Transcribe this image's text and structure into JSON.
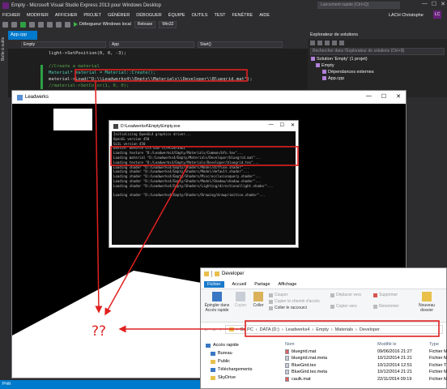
{
  "vs": {
    "title": "Empty - Microsoft Visual Studio Express 2013 pour Windows Desktop",
    "quick_launch": "Lancement rapide (Ctrl+Q)",
    "window_buttons": [
      "—",
      "☐",
      "✕"
    ],
    "menu": [
      "FICHIER",
      "MODIFIER",
      "AFFICHER",
      "PROJET",
      "GÉNÉRER",
      "DÉBOGUER",
      "ÉQUIPE",
      "OUTILS",
      "TEST",
      "FENÊTRE",
      "AIDE"
    ],
    "user": "LACH Christophe",
    "user_initials": "LC",
    "toolbar": {
      "run_label": "Débogueur Windows local",
      "config": "Release",
      "platform": "Win32"
    },
    "left_strip_label": "Boîte à outils",
    "editor_tab": "App.cpp",
    "nav": [
      "Empty",
      "App",
      "Start()"
    ],
    "code_lines": [
      "light->SetPosition(0, 0, -3);",
      "",
      "//Create a material",
      "Material* material = Material::Create();",
      "material->Load(\"D:\\\\Leadwerks4\\\\Empty\\\\Materials\\\\Developer\\\\Bluegrid.mat\");",
      "//material->SetColor(1, 0, 0);"
    ],
    "solution": {
      "header": "Explorateur de solutions",
      "search": "Rechercher dans l'Explorateur de solutions (Ctrl+$)",
      "tree": [
        "Solution 'Empty' (1 projet)",
        "Empty",
        "Dépendances externes",
        "App.cpp"
      ]
    },
    "status": "Prêt"
  },
  "leadwerks": {
    "title": "Leadwerks",
    "window_buttons": [
      "—",
      "☐",
      "✕"
    ]
  },
  "console": {
    "title": "D:\\Leadwerks4\\Empty\\Empty.exe",
    "window_buttons": [
      "—",
      "☐",
      "✕"
    ],
    "lines": [
      "Initializing OpenGL4 graphics driver...",
      "OpenGL version 450",
      "GLSL version 450",
      "Device: GeForce GTX 650 Ti/PCIe/SSE2",
      "Loading texture \"D:/Leadwerks4/Empty/Materials/Common/bfn.tex\"...",
      "Loading material \"D:/Leadwerks4/Empty/Materials/Developer/bluegrid.mat\"...",
      "Loading texture \"D:/Leadwerks4/Empty/Materials/Developer/bluegrid.tex\"...",
      "Loading shader \"D:/Leadwerks4/Empty/Shaders/Model/diffuse.shader\"...",
      "Loading shader \"D:/Leadwerks4/Empty/Shaders/Model/default.shader\"...",
      "Loading shader \"D:/Leadwerks4/Empty/Shaders/Misc/occlusionquery.shader\"...",
      "Loading shader \"D:/Leadwerks4/Empty/Shaders/Model/Shadow/shadow.shader\"...",
      "Loading shader \"D:/Leadwerks4/Empty/Shaders/Lighting/directionallight.shader\"...",
      "",
      "Loading shader \"D:/Leadwerks4/Empty/Shaders/Drawing/drawprimitive.shader\"..."
    ]
  },
  "explorer": {
    "title": "Developer",
    "ribbon_tabs": [
      "Fichier",
      "Accueil",
      "Partage",
      "Affichage"
    ],
    "ribbon": {
      "pin": "Épingler dans Accès rapide",
      "copy": "Copier",
      "paste": "Coller",
      "cut": "Couper",
      "copy_path": "Copier le chemin d'accès",
      "paste_shortcut": "Coller le raccourci",
      "move_to": "Déplacer vers",
      "copy_to": "Copier vers",
      "delete": "Supprimer",
      "rename": "Renommer",
      "new_folder": "Nouveau dossier"
    },
    "breadcrumb": [
      "Ce PC",
      "DATA (D:)",
      "Leadwerks4",
      "Empty",
      "Materials",
      "Developer"
    ],
    "nav": [
      "Accès rapide",
      "Bureau",
      "Public",
      "Téléchargements",
      "SkyDrive"
    ],
    "columns": [
      "Nom",
      "Modifié le",
      "Type"
    ],
    "files": [
      {
        "name": "bluegrid.mat",
        "date": "09/06/2016 21:27",
        "type": "Fichier M"
      },
      {
        "name": "bluegrid.mat.meta",
        "date": "10/12/2014 21:21",
        "type": "Fichier M"
      },
      {
        "name": "BlueGrid.tex",
        "date": "10/12/2014 12:51",
        "type": "Fichier T"
      },
      {
        "name": "BlueGrid.tex.meta",
        "date": "10/12/2014 21:21",
        "type": "Fichier M"
      },
      {
        "name": "caulk.mat",
        "date": "22/11/2014 09:19",
        "type": "Fichier M"
      }
    ]
  },
  "annotation": {
    "question": "??",
    "color": "#e02020"
  }
}
